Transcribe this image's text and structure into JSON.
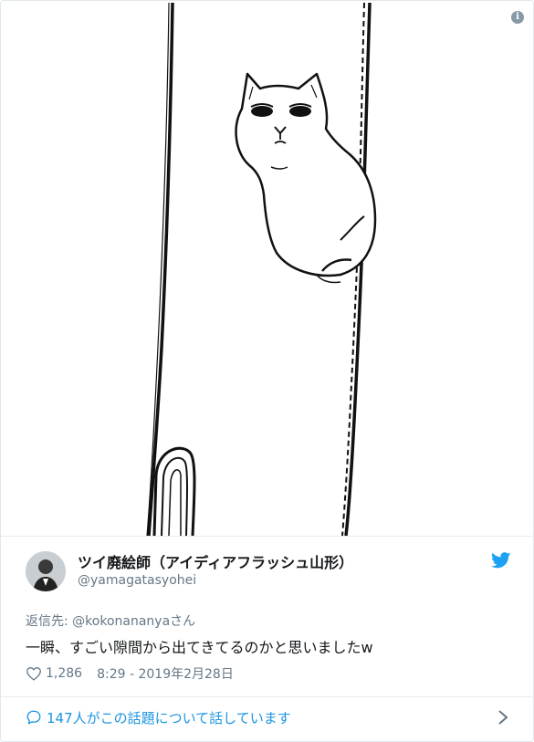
{
  "tweet": {
    "display_name": "ツイ廃絵師（アイディアフラッシュ山形）",
    "handle": "@yamagatasyohei",
    "reply_prefix": "返信先: ",
    "reply_mention": "@kokonananya",
    "reply_suffix": "さん",
    "text": "一瞬、すごい隙間から出てきてるのかと思いましたw",
    "likes": "1,286",
    "timestamp": "8:29 - 2019年2月28日"
  },
  "conversation": {
    "label": "147人がこの話題について話しています"
  },
  "icons": {
    "info": "info-icon",
    "bird": "twitter-bird-icon",
    "heart": "heart-icon",
    "bubble": "speech-bubble-icon",
    "chevron": "chevron-right-icon"
  },
  "colors": {
    "accent": "#1b95e0",
    "secondary_text": "#657786",
    "primary_text": "#14171a",
    "divider": "#e6ecf0"
  }
}
